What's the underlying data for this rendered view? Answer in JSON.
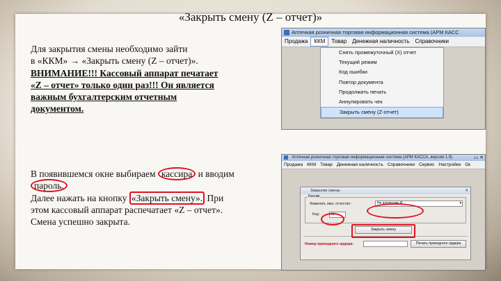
{
  "slide": {
    "title": "«Закрыть смену (Z – отчет)»",
    "para1": {
      "line1": "Для закрытия смены необходимо зайти",
      "line2": "в «ККМ» → «Закрыть смену (Z – отчет)».",
      "warn1": "ВНИМАНИЕ!!! Кассовый аппарат печатает",
      "warn2": "«Z – отчет» только один раз!!! Он является",
      "warn3": "важным бухгалтерским отчетным",
      "warn4": "документом."
    },
    "para2": {
      "a1": "В появившемся окне выбираем ",
      "a_oval": "кассира",
      "a2": " и вводим",
      "b_oval": "пароль.",
      "c1": "Далее нажать на кнопку ",
      "c_box": "«Закрыть смену».",
      "c2": " При",
      "d": "этом кассовый аппарат распечатает «Z – отчет».",
      "e": "Смена успешно закрыта."
    }
  },
  "shot1": {
    "window_title": "Аптечная розничная торговая информационная система  (АРМ КАСС",
    "menu": [
      "Продажа",
      "ККМ",
      "Товар",
      "Денежная наличность",
      "Справочники"
    ],
    "dropdown": [
      "Снять промежуточный (X) отчет",
      "Текущий режим",
      "Код ошибки",
      "Повтор документа",
      "Продолжить печать",
      "Аннулировать чек",
      "Закрыть смену (Z-отчет)"
    ]
  },
  "shot2": {
    "window_title": "Аптечная розничная торговая информационная система  (АРМ КАССА, версия 1.9)",
    "menu": [
      "Продажа",
      "ККМ",
      "Товар",
      "Денежная наличность",
      "Справочники",
      "Сервис",
      "Настройки",
      "Ок"
    ],
    "dialog_title": "Закрытие смены",
    "group_label": "Кассир",
    "fio_label": "Фамилия, имя, отчество:",
    "fio_value": "Не изгородин И.",
    "code_label": "Код:",
    "code_value": "Id",
    "close_button": "Закрыть смену",
    "order_label": "Номер приходного ордера:",
    "print_button": "Печать приходного ордера"
  }
}
